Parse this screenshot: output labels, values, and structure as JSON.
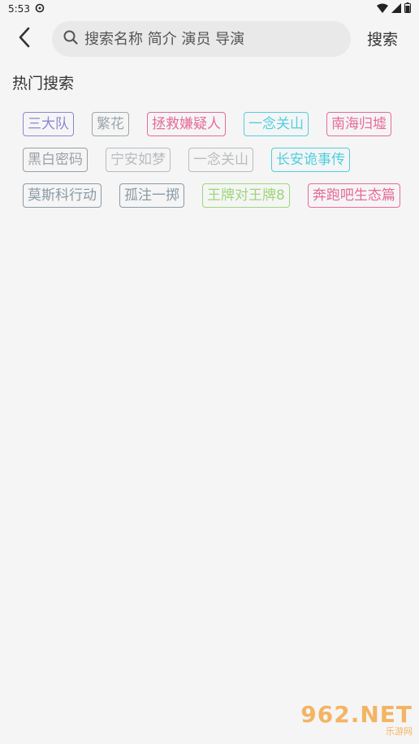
{
  "status_bar": {
    "time": "5:53",
    "icons": [
      "sync-icon",
      "wifi-icon",
      "signal-icon",
      "battery-icon"
    ]
  },
  "header": {
    "back_icon": "back-arrow-icon",
    "search_placeholder": "搜索名称 简介 演员 导演",
    "search_icon": "search-icon",
    "search_button_label": "搜索"
  },
  "hot_search": {
    "title": "热门搜索",
    "tags": [
      {
        "label": "三大队",
        "color": "#8b86d4"
      },
      {
        "label": "繁花",
        "color": "#9aa7ae"
      },
      {
        "label": "拯救嫌疑人",
        "color": "#e66a9a"
      },
      {
        "label": "一念关山",
        "color": "#4fd0e0"
      },
      {
        "label": "南海归墟",
        "color": "#e66a9a"
      },
      {
        "label": "黑白密码",
        "color": "#9aa0a6"
      },
      {
        "label": "宁安如梦",
        "color": "#b8bcbf"
      },
      {
        "label": "一念关山",
        "color": "#b8bcbf"
      },
      {
        "label": "长安诡事传",
        "color": "#4fd0e0"
      },
      {
        "label": "莫斯科行动",
        "color": "#8a9aa6"
      },
      {
        "label": "孤注一掷",
        "color": "#8a9aa6"
      },
      {
        "label": "王牌对王牌8",
        "color": "#9ed67a"
      },
      {
        "label": "奔跑吧生态篇",
        "color": "#e66a9a"
      }
    ]
  },
  "watermark": {
    "logo_text": "962.NET",
    "sub_text": "乐游网"
  }
}
